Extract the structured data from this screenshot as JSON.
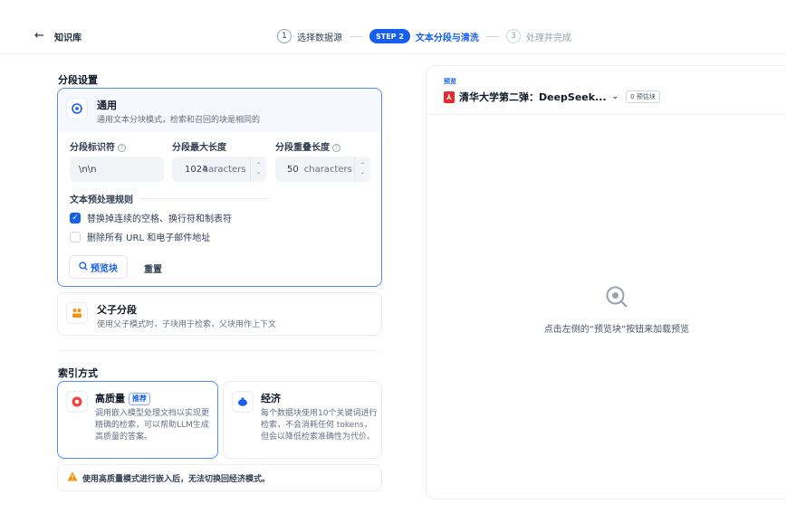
{
  "header": {
    "back_icon": "arrow-left-icon",
    "breadcrumb": "知识库",
    "steps": [
      {
        "number": "1",
        "label": "选择数据源"
      },
      {
        "pill": "STEP 2",
        "label": "文本分段与清洗"
      },
      {
        "number": "3",
        "label": "处理并完成"
      }
    ]
  },
  "segment": {
    "section_title": "分段设置",
    "general": {
      "title": "通用",
      "desc": "通用文本分块模式，检索和召回的块是相同的",
      "fields": {
        "delimiter_label": "分段标识符",
        "delimiter_value": "\\n\\n",
        "max_length_label": "分段最大长度",
        "max_length_value": "1024",
        "max_length_unit": "characters",
        "overlap_label": "分段重叠长度",
        "overlap_value": "50",
        "overlap_unit": "characters"
      },
      "preprocess_title": "文本预处理规则",
      "rules": [
        {
          "label": "替换掉连续的空格、换行符和制表符",
          "checked": true
        },
        {
          "label": "删除所有 URL 和电子邮件地址",
          "checked": false
        }
      ],
      "preview_button": "预览块",
      "reset_button": "重置"
    },
    "parent_child": {
      "title": "父子分段",
      "desc": "使用父子模式时，子块用于检索，父块用作上下文"
    }
  },
  "index": {
    "section_title": "索引方式",
    "high_quality": {
      "title": "高质量",
      "badge": "推荐",
      "desc": "调用嵌入模型处理文档以实现更精确的检索，可以帮助LLM生成高质量的答案。"
    },
    "economy": {
      "title": "经济",
      "desc": "每个数据块使用10个关键词进行检索，不会消耗任何 tokens，但会以降低检索准确性为代价。"
    },
    "warning": "使用高质量模式进行嵌入后，无法切换回经济模式。"
  },
  "preview": {
    "tag": "预览",
    "doc_name": "清华大学第二弹：DeepSeek...",
    "chunk_badge": "0 预估块",
    "empty_text": "点击左侧的“预览块”按钮来加载预览"
  },
  "colors": {
    "accent": "#155eef",
    "warning": "#f79009",
    "pdf": "#e02d2d"
  }
}
